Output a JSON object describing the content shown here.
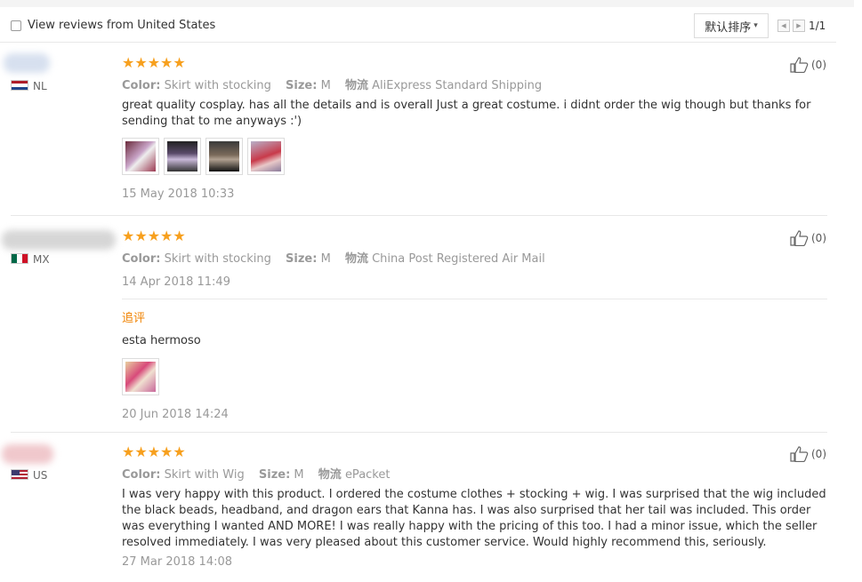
{
  "filter": {
    "label": "View reviews from United States"
  },
  "sort": {
    "label": "默认排序",
    "chevron": "chevron-down-icon"
  },
  "pager": {
    "text": "1/1"
  },
  "reviews": [
    {
      "country": "NL",
      "stars": "★★★★★",
      "rating": 5,
      "color_key": "Color:",
      "color_val": "Skirt with stocking",
      "size_key": "Size:",
      "size_val": "M",
      "ship_key": "物流",
      "ship_val": "AliExpress Standard Shipping",
      "text": "great quality cosplay. has all the details and is overall Just a great costume. i didnt order the wig though but thanks for sending that to me anyways :')",
      "date": "15 May 2018 10:33",
      "likes": "(0)"
    },
    {
      "country": "MX",
      "stars": "★★★★★",
      "rating": 5,
      "color_key": "Color:",
      "color_val": "Skirt with stocking",
      "size_key": "Size:",
      "size_val": "M",
      "ship_key": "物流",
      "ship_val": "China Post Registered Air Mail",
      "date": "14 Apr 2018 11:49",
      "additional_label": "追评",
      "additional_text": "esta hermoso",
      "additional_date": "20 Jun 2018 14:24",
      "likes": "(0)"
    },
    {
      "country": "US",
      "stars": "★★★★★",
      "rating": 5,
      "color_key": "Color:",
      "color_val": "Skirt with Wig",
      "size_key": "Size:",
      "size_val": "M",
      "ship_key": "物流",
      "ship_val": "ePacket",
      "text": "I was very happy with this product. I ordered the costume clothes + stocking + wig. I was surprised that the wig included the black beads, headband, and dragon ears that Kanna has. I was also surprised that her tail was included. This order was everything I wanted AND MORE! I was really happy with the pricing of this too. I had a minor issue, which the seller resolved immediately. I was very pleased about this customer service. Would highly recommend this, seriously.",
      "date": "27 Mar 2018 14:08",
      "likes": "(0)"
    }
  ],
  "colors": {
    "star": "#f7a01e",
    "additional": "#f08200",
    "muted": "#999999"
  }
}
